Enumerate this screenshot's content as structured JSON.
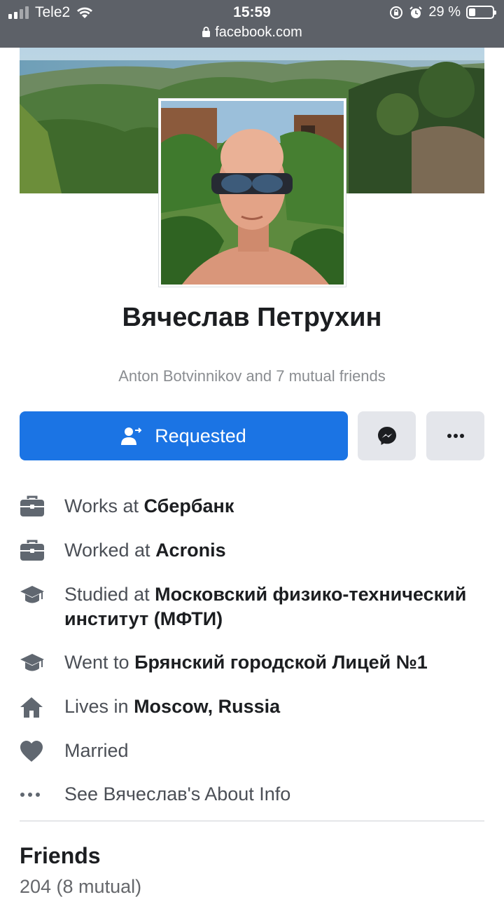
{
  "status_bar": {
    "carrier": "Tele2",
    "time": "15:59",
    "url": "facebook.com",
    "battery_percent": "29 %",
    "battery_level": 0.29
  },
  "profile": {
    "name": "Вячеслав Петрухин",
    "mutual_friends": "Anton Botvinnikov and 7 mutual friends"
  },
  "actions": {
    "primary_label": "Requested",
    "primary_icon": "friend-request-sent-icon",
    "message_icon": "messenger-icon",
    "more_icon": "more-icon"
  },
  "info": [
    {
      "icon": "briefcase-icon",
      "prefix": "Works at ",
      "value": "Сбербанк"
    },
    {
      "icon": "briefcase-icon",
      "prefix": "Worked at ",
      "value": "Acronis"
    },
    {
      "icon": "graduation-cap-icon",
      "prefix": "Studied at ",
      "value": "Московский физико-технический институт (МФТИ)"
    },
    {
      "icon": "graduation-cap-icon",
      "prefix": "Went to ",
      "value": "Брянский городской Лицей №1"
    },
    {
      "icon": "home-icon",
      "prefix": "Lives in ",
      "value": "Moscow, Russia"
    },
    {
      "icon": "heart-icon",
      "prefix": "Married",
      "value": ""
    },
    {
      "icon": "more-dots-icon",
      "prefix": "See Вячеслав's About Info",
      "value": ""
    }
  ],
  "friends": {
    "title": "Friends",
    "count": "204 (8 mutual)"
  },
  "colors": {
    "primary_button": "#1b74e4",
    "secondary_button": "#e4e6eb",
    "status_bar": "#5d6168",
    "icon_gray": "#606770"
  }
}
